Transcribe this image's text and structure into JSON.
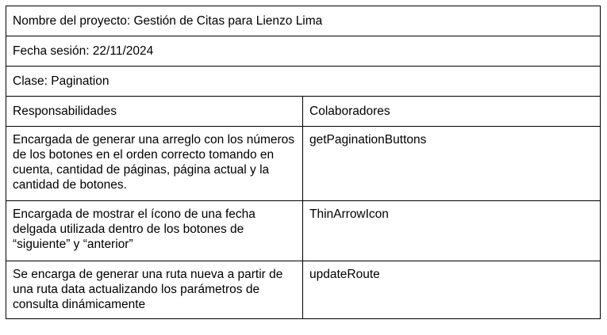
{
  "card": {
    "project": "Nombre del proyecto: Gestión de Citas para Lienzo Lima",
    "session_date": "Fecha sesión: 22/11/2024",
    "class_name": "Clase: Pagination",
    "headers": {
      "responsibilities": "Responsabilidades",
      "collaborators": "Colaboradores"
    },
    "rows": [
      {
        "responsibility": "Encargada de generar una arreglo con los números de los botones en el orden correcto tomando en cuenta, cantidad de páginas, página actual y la cantidad de botones.",
        "collaborator": "getPaginationButtons"
      },
      {
        "responsibility": "Encargada de mostrar el ícono de una fecha delgada utilizada dentro de los botones de “siguiente” y “anterior”",
        "collaborator": "ThinArrowIcon"
      },
      {
        "responsibility": "Se encarga de generar una ruta nueva a partir de una ruta data actualizando los parámetros de consulta dinámicamente",
        "collaborator": "updateRoute"
      }
    ]
  }
}
